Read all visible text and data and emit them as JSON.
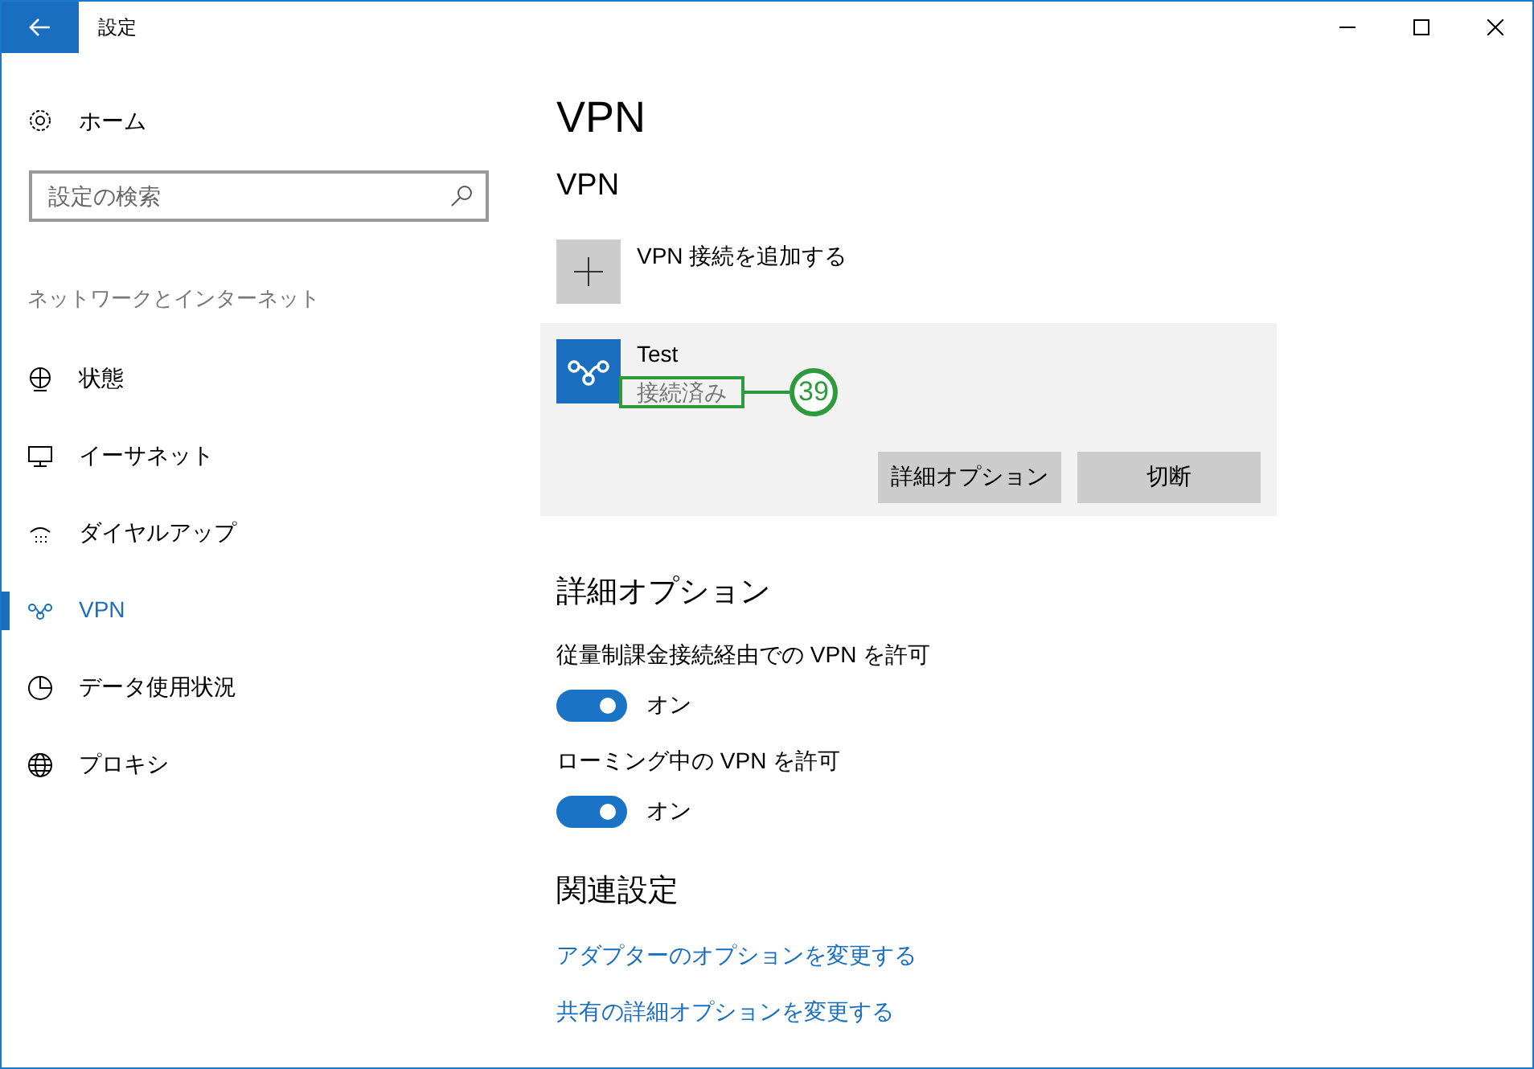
{
  "window": {
    "title": "設定"
  },
  "sidebar": {
    "home": "ホーム",
    "search": {
      "placeholder": "設定の検索"
    },
    "section": "ネットワークとインターネット",
    "items": [
      {
        "label": "状態",
        "kind": "status",
        "selected": false
      },
      {
        "label": "イーサネット",
        "kind": "ethernet",
        "selected": false
      },
      {
        "label": "ダイヤルアップ",
        "kind": "dialup",
        "selected": false
      },
      {
        "label": "VPN",
        "kind": "vpn",
        "selected": true
      },
      {
        "label": "データ使用状況",
        "kind": "data",
        "selected": false
      },
      {
        "label": "プロキシ",
        "kind": "proxy",
        "selected": false
      }
    ]
  },
  "page_title": "VPN",
  "vpn_section": {
    "heading": "VPN",
    "add_label": "VPN 接続を追加する",
    "connection": {
      "name": "Test",
      "status": "接続済み",
      "callout": "39",
      "buttons": [
        "詳細オプション",
        "切断"
      ]
    }
  },
  "advanced": {
    "heading": "詳細オプション",
    "toggles": [
      {
        "label": "従量制課金接続経由での VPN を許可",
        "on": true,
        "state_text": "オン"
      },
      {
        "label": "ローミング中の VPN を許可",
        "on": true,
        "state_text": "オン"
      }
    ]
  },
  "related": {
    "heading": "関連設定",
    "links": [
      "アダプターのオプションを変更する",
      "共有の詳細オプションを変更する"
    ]
  }
}
